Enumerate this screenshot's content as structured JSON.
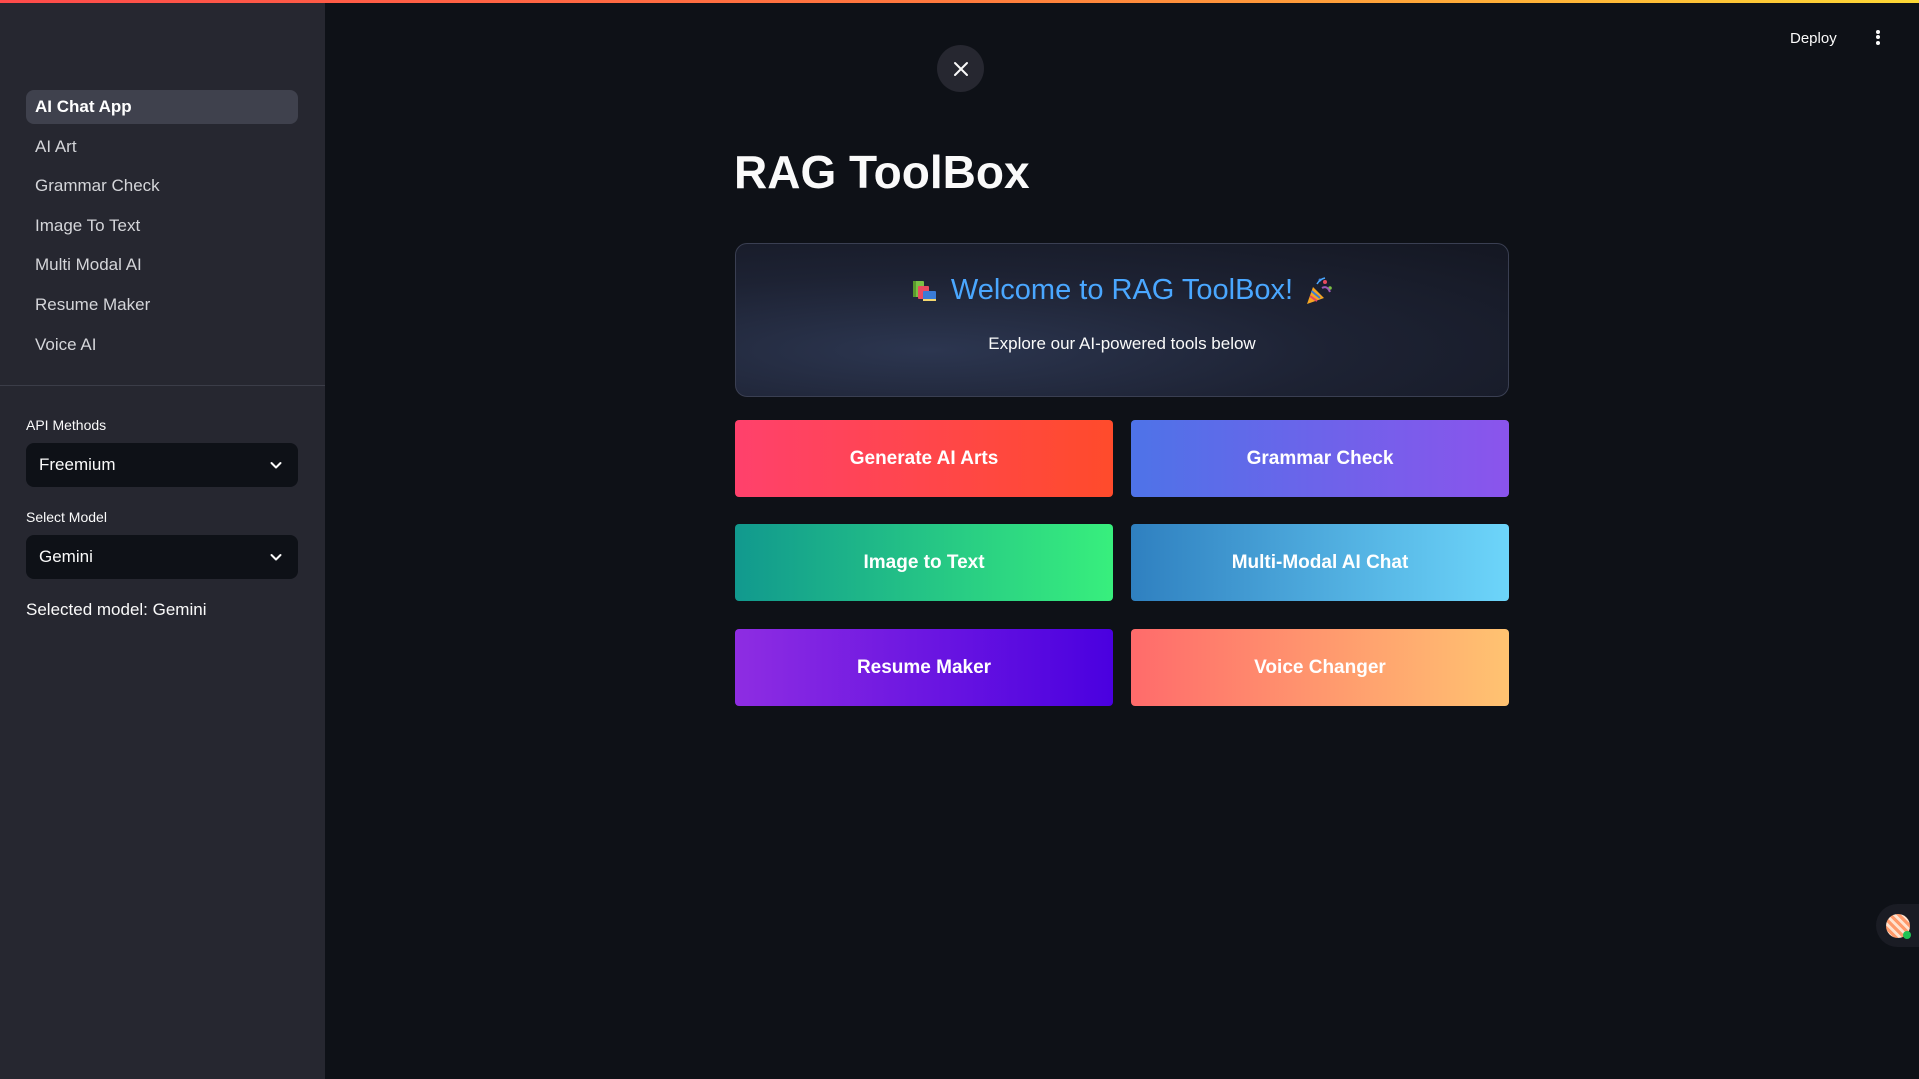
{
  "header": {
    "deploy_label": "Deploy"
  },
  "sidebar": {
    "nav_items": [
      {
        "label": "AI Chat App"
      },
      {
        "label": "AI Art"
      },
      {
        "label": "Grammar Check"
      },
      {
        "label": "Image To Text"
      },
      {
        "label": "Multi Modal AI"
      },
      {
        "label": "Resume Maker"
      },
      {
        "label": "Voice AI"
      }
    ],
    "active_item": "AI Chat App",
    "api_methods": {
      "label": "API Methods",
      "value": "Freemium"
    },
    "select_model": {
      "label": "Select Model",
      "value": "Gemini"
    },
    "selected_model_text": "Selected model: Gemini"
  },
  "main": {
    "title": "RAG ToolBox",
    "welcome": {
      "heading": "Welcome to RAG ToolBox!",
      "subtitle": "Explore our AI-powered tools below",
      "icons": [
        "books-icon",
        "party-popper-icon"
      ]
    },
    "tools": [
      {
        "label": "Generate AI Arts"
      },
      {
        "label": "Grammar Check"
      },
      {
        "label": "Image to Text"
      },
      {
        "label": "Multi-Modal AI Chat"
      },
      {
        "label": "Resume Maker"
      },
      {
        "label": "Voice Changer"
      }
    ]
  },
  "colors": {
    "background": "#0e1117",
    "sidebar": "#262730",
    "accent_heading": "#4aa7ff",
    "status_online": "#21c354"
  }
}
